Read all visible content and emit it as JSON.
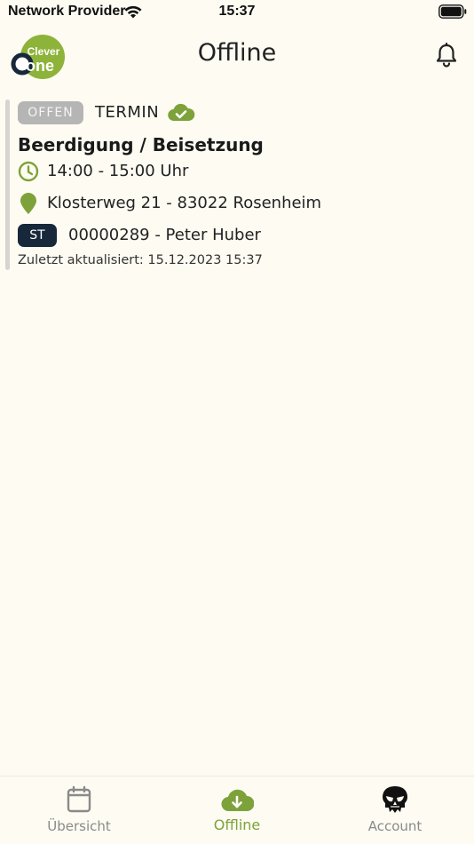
{
  "status_bar": {
    "provider": "Network Provider",
    "time": "15:37"
  },
  "header": {
    "logo_text_top": "Clever",
    "logo_text_bottom": "one",
    "title": "Offline"
  },
  "card": {
    "status": "OFFEN",
    "type": "TERMIN",
    "title": "Beerdigung / Beisetzung",
    "time": "14:00 - 15:00 Uhr",
    "address": "Klosterweg 21 - 83022 Rosenheim",
    "person_badge": "ST",
    "person": "00000289 - Peter Huber",
    "updated": "Zuletzt aktualisiert: 15.12.2023 15:37"
  },
  "tabs": [
    {
      "label": "Übersicht",
      "icon": "calendar-icon",
      "active": false
    },
    {
      "label": "Offline",
      "icon": "cloud-download-icon",
      "active": true
    },
    {
      "label": "Account",
      "icon": "skull-icon",
      "active": false
    }
  ],
  "colors": {
    "accent": "#7da23a",
    "background": "#fdfbf2",
    "badge_grey": "#b5b5b5",
    "badge_dark": "#16283a"
  }
}
